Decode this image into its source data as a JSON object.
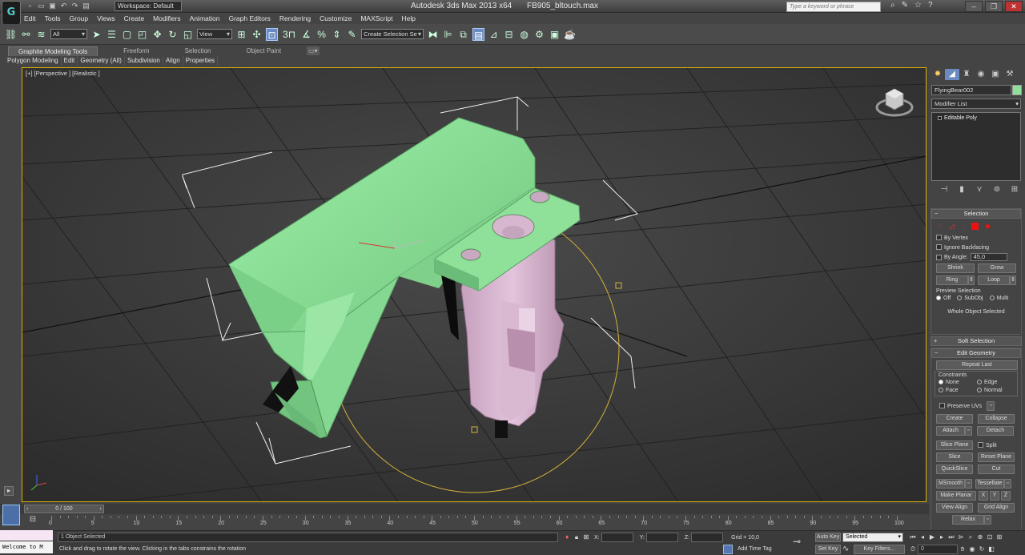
{
  "window": {
    "app_title": "Autodesk 3ds Max  2013 x64",
    "file_title": "FB905_bltouch.max",
    "workspace": "Workspace: Default",
    "search_placeholder": "Type a keyword or phrase"
  },
  "menu": [
    "Edit",
    "Tools",
    "Group",
    "Views",
    "Create",
    "Modifiers",
    "Animation",
    "Graph Editors",
    "Rendering",
    "Customize",
    "MAXScript",
    "Help"
  ],
  "toolbar": {
    "selection_filter": "All",
    "ref_coord": "View",
    "snap_label": "3",
    "selection_set": "Create Selection Se"
  },
  "ribbon": {
    "tabs": [
      "Graphite Modeling Tools",
      "Freeform",
      "Selection",
      "Object Paint"
    ],
    "items": [
      "Polygon Modeling",
      "Edit",
      "Geometry (All)",
      "Subdivision",
      "Align",
      "Properties"
    ]
  },
  "viewport": {
    "label": "[+] [Perspective ] [Realistic ]",
    "green_color": "#8fe19a",
    "pink_color": "#d8b7d0",
    "gizmo_color": "#d4b13a"
  },
  "panel": {
    "object_name": "FlyingBear002",
    "modifier_list": "Modifier List",
    "stack_item": "Editable Poly",
    "selection": {
      "title": "Selection",
      "by_vertex": "By Vertex",
      "ignore_backfacing": "Ignore Backfacing",
      "by_angle": "By Angle:",
      "angle_value": "45,0",
      "shrink": "Shrink",
      "grow": "Grow",
      "ring": "Ring",
      "loop": "Loop",
      "preview_label": "Preview Selection",
      "off": "Off",
      "subobj": "SubObj",
      "multi": "Multi",
      "status": "Whole Object Selected"
    },
    "soft_selection": "Soft Selection",
    "edit_geometry": {
      "title": "Edit Geometry",
      "repeat_last": "Repeat Last",
      "constraints": "Constraints",
      "none": "None",
      "edge": "Edge",
      "face": "Face",
      "normal": "Normal",
      "preserve_uvs": "Preserve UVs",
      "create": "Create",
      "collapse": "Collapse",
      "attach": "Attach",
      "detach": "Detach",
      "slice_plane": "Slice Plane",
      "split": "Split",
      "slice": "Slice",
      "reset_plane": "Reset Plane",
      "quickslice": "QuickSlice",
      "cut": "Cut",
      "msmooth": "MSmooth",
      "tessellate": "Tessellate",
      "make_planar": "Make Planar",
      "x": "X",
      "y": "Y",
      "z": "Z",
      "view_align": "View Align",
      "grid_align": "Grid Align",
      "relax": "Relax"
    }
  },
  "timeline": {
    "slider_text": "0 / 100",
    "ticks": [
      "0",
      "5",
      "10",
      "15",
      "20",
      "25",
      "30",
      "35",
      "40",
      "45",
      "50",
      "55",
      "60",
      "65",
      "70",
      "75",
      "80",
      "85",
      "90",
      "95",
      "100"
    ]
  },
  "status": {
    "listener": "Welcome to M",
    "selected": "1 Object Selected",
    "prompt": "Click and drag to rotate the view.  Clicking in the tabs constrains the rotation",
    "x_label": "X:",
    "y_label": "Y:",
    "z_label": "Z:",
    "grid": "Grid = 10,0",
    "auto_key": "Auto Key",
    "key_mode": "Selected",
    "set_key": "Set Key",
    "key_filters": "Key Filters...",
    "add_time_tag": "Add Time Tag",
    "frame": "0"
  }
}
